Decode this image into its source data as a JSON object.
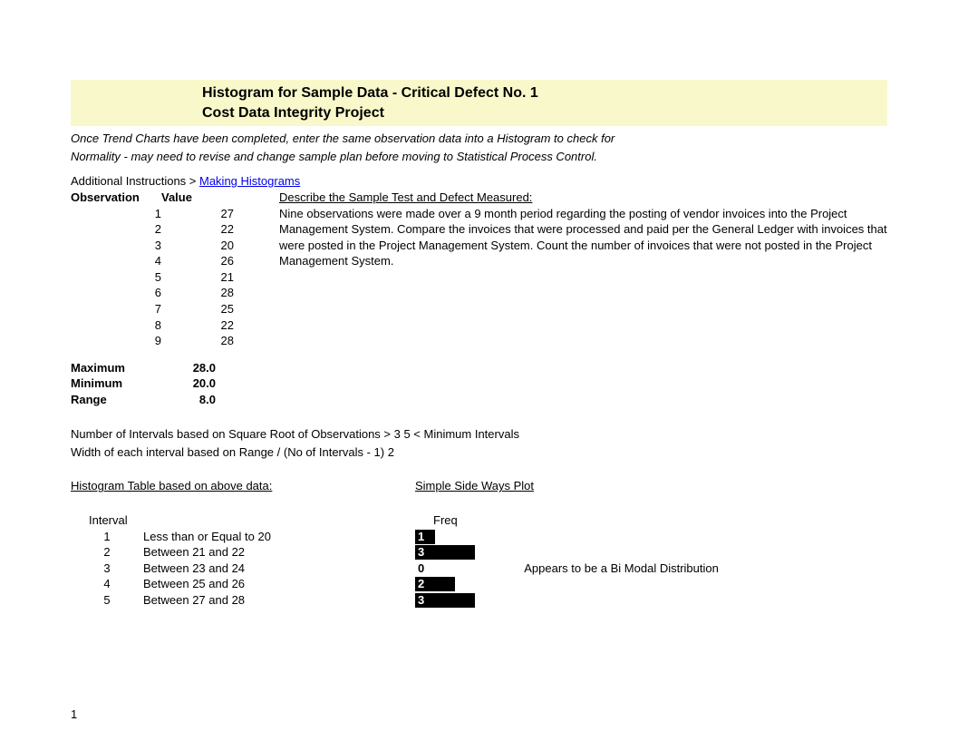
{
  "title1": "Histogram for Sample Data - Critical Defect No. 1",
  "title2": "Cost Data Integrity Project",
  "intro_line1": "Once Trend Charts have been completed, enter the same observation data into a Histogram to check for",
  "intro_line2": "Normality - may need to revise and change sample plan before moving to Statistical Process Control.",
  "addl_prefix": "Additional Instructions >  ",
  "addl_link": "Making Histograms",
  "obs_header_col1": "Observation",
  "obs_header_col2": "Value",
  "observations": [
    {
      "n": "1",
      "v": "27"
    },
    {
      "n": "2",
      "v": "22"
    },
    {
      "n": "3",
      "v": "20"
    },
    {
      "n": "4",
      "v": "26"
    },
    {
      "n": "5",
      "v": "21"
    },
    {
      "n": "6",
      "v": "28"
    },
    {
      "n": "7",
      "v": "25"
    },
    {
      "n": "8",
      "v": "22"
    },
    {
      "n": "9",
      "v": "28"
    }
  ],
  "desc_header": "Describe the Sample Test and Defect Measured:",
  "desc_body": "Nine observations were made over a 9 month period regarding the posting of vendor invoices into the Project Management System. Compare the invoices that were processed and paid per the General Ledger with invoices that were posted in the Project Management System. Count the number of invoices that were not posted in the Project Management System.",
  "stat_max_lbl": "Maximum",
  "stat_max_val": "28.0",
  "stat_min_lbl": "Minimum",
  "stat_min_val": "20.0",
  "stat_range_lbl": "Range",
  "stat_range_val": "8.0",
  "intervals_line1": "Number of Intervals based on Square Root of Observations >  3   5  < Minimum Intervals",
  "intervals_line2": "Width of each interval based on Range / (No of Intervals - 1)    2",
  "histo_table_hdr": "Histogram Table based on above data:",
  "histo_plot_hdr": "Simple Side Ways Plot",
  "histo_col_interval": "Interval",
  "histo_col_freq": "Freq",
  "histo_rows": [
    {
      "n": "1",
      "label": "Less than or Equal to 20",
      "freq": 1,
      "note": ""
    },
    {
      "n": "2",
      "label": "Between 21 and 22",
      "freq": 3,
      "note": ""
    },
    {
      "n": "3",
      "label": "Between 23 and 24",
      "freq": 0,
      "note": "Appears to be a Bi Modal Distribution"
    },
    {
      "n": "4",
      "label": "Between 25 and 26",
      "freq": 2,
      "note": ""
    },
    {
      "n": "5",
      "label": "Between 27 and 28",
      "freq": 3,
      "note": ""
    }
  ],
  "chart_data": {
    "type": "bar",
    "orientation": "horizontal",
    "title": "Simple Side Ways Plot",
    "xlabel": "Freq",
    "ylabel": "Interval",
    "categories": [
      "Less than or Equal to 20",
      "Between 21 and 22",
      "Between 23 and 24",
      "Between 25 and 26",
      "Between 27 and 28"
    ],
    "values": [
      1,
      3,
      0,
      2,
      3
    ],
    "annotation": "Appears to be a Bi Modal Distribution"
  },
  "page_number": "1"
}
